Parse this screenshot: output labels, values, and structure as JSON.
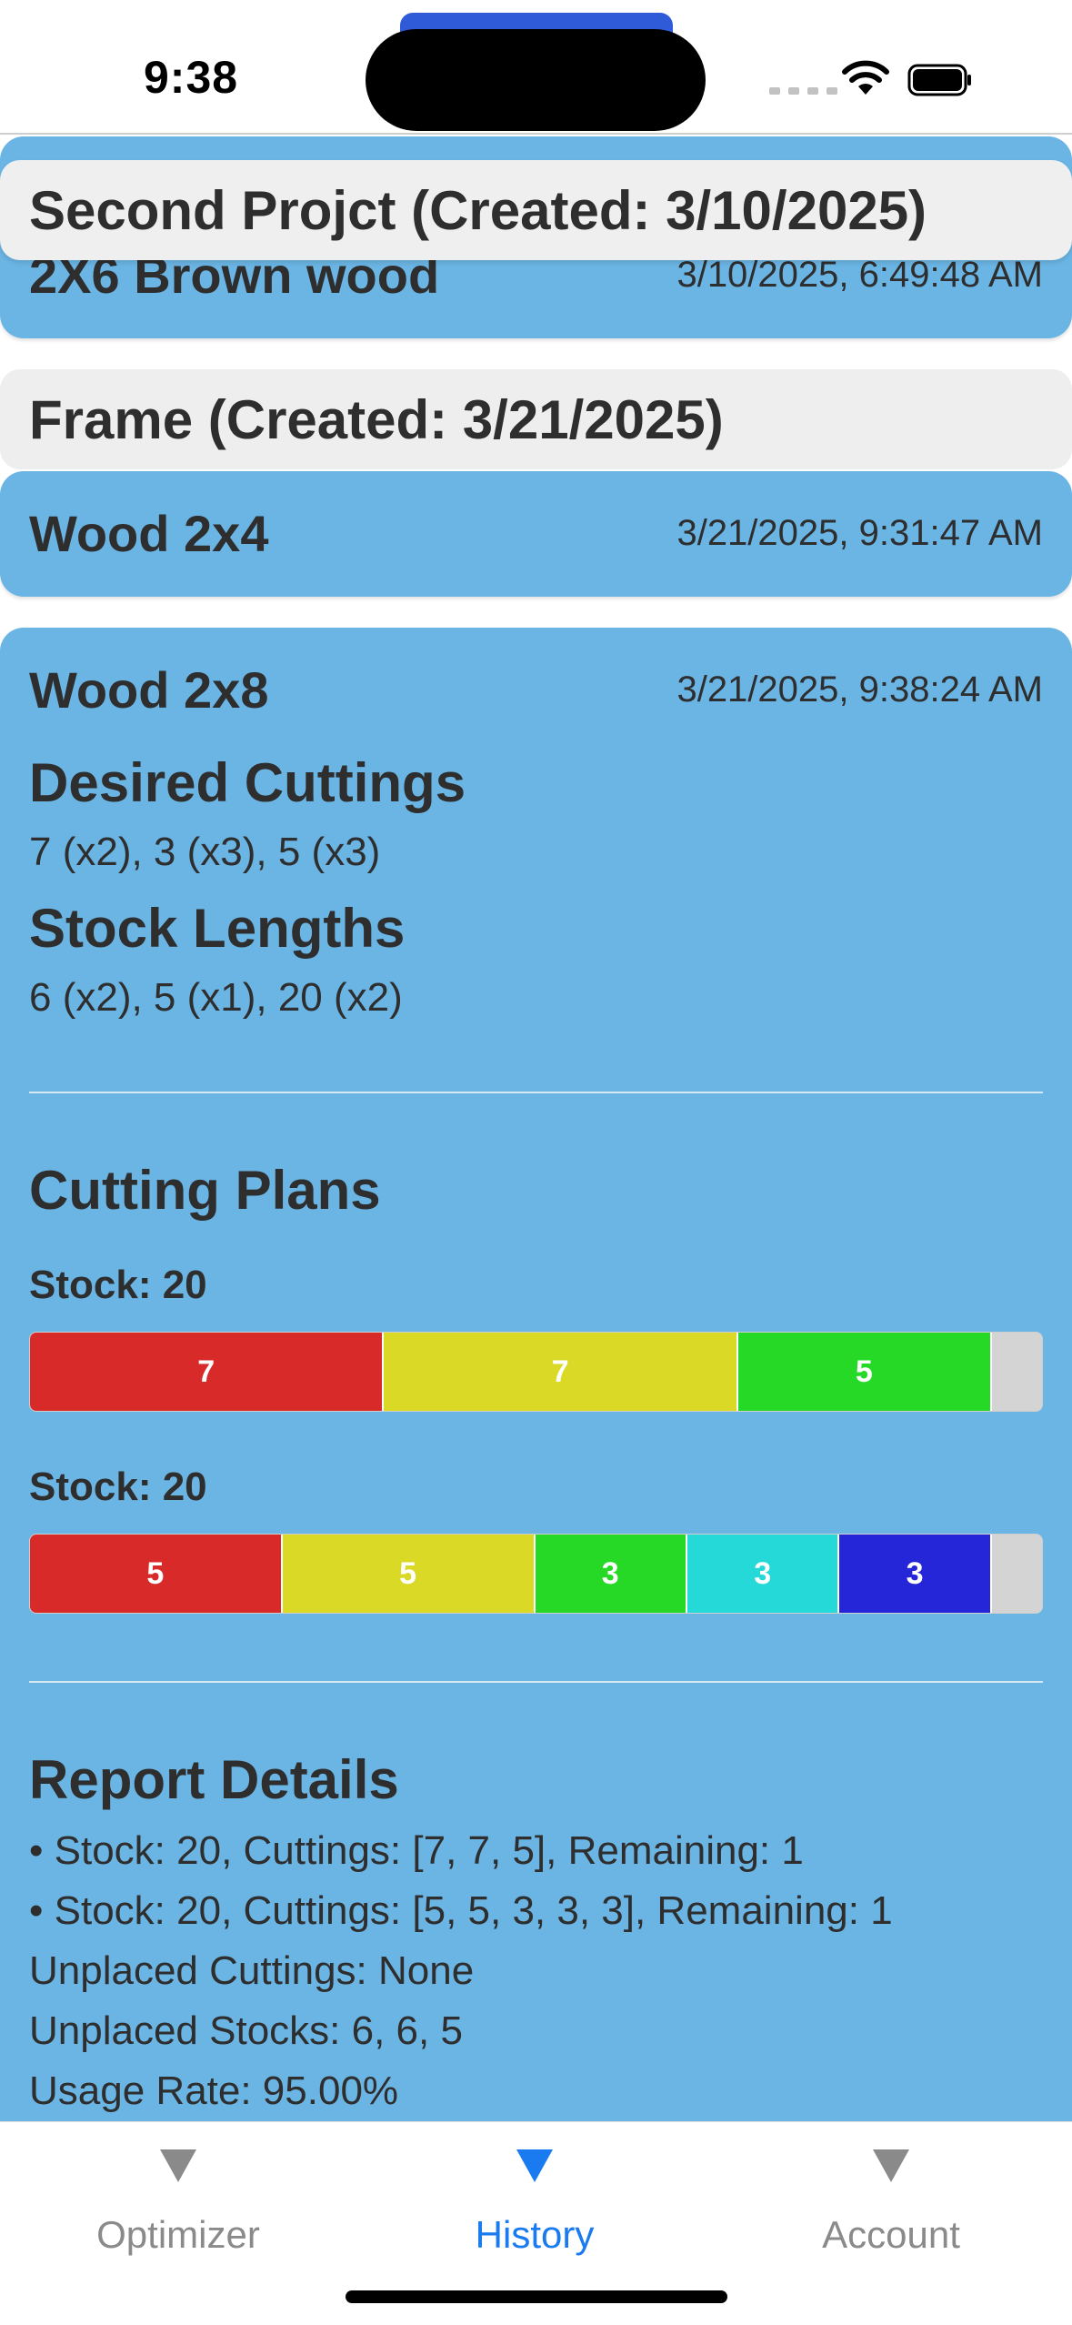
{
  "status_bar": {
    "time": "9:38"
  },
  "history": {
    "projects": [
      {
        "header": "Second Projct (Created: 3/10/2025)",
        "items": [
          {
            "title": "2X6 Brown wood",
            "date": "3/10/2025, 6:49:48 AM"
          }
        ]
      },
      {
        "header": "Frame (Created: 3/21/2025)",
        "items": [
          {
            "title": "Wood 2x4",
            "date": "3/21/2025, 9:31:47 AM"
          },
          {
            "title": "Wood 2x8",
            "date": "3/21/2025, 9:38:24 AM",
            "desired_cuttings_heading": "Desired Cuttings",
            "desired_cuttings": "7 (x2), 3 (x3), 5 (x3)",
            "stock_lengths_heading": "Stock Lengths",
            "stock_lengths": "6 (x2), 5 (x1), 20 (x2)",
            "cutting_plans_heading": "Cutting Plans",
            "plans": [
              {
                "label": "Stock: 20",
                "stock": 20,
                "cuts": [
                  {
                    "value": 7,
                    "label": "7",
                    "color": "#d92a2a"
                  },
                  {
                    "value": 7,
                    "label": "7",
                    "color": "#d9d926"
                  },
                  {
                    "value": 5,
                    "label": "5",
                    "color": "#26d926"
                  }
                ],
                "remaining": 1
              },
              {
                "label": "Stock: 20",
                "stock": 20,
                "cuts": [
                  {
                    "value": 5,
                    "label": "5",
                    "color": "#d92a2a"
                  },
                  {
                    "value": 5,
                    "label": "5",
                    "color": "#d9d926"
                  },
                  {
                    "value": 3,
                    "label": "3",
                    "color": "#26d926"
                  },
                  {
                    "value": 3,
                    "label": "3",
                    "color": "#26d9d9"
                  },
                  {
                    "value": 3,
                    "label": "3",
                    "color": "#2626d9"
                  }
                ],
                "remaining": 1
              }
            ],
            "report_heading": "Report Details",
            "report_lines": [
              "• Stock: 20, Cuttings: [7, 7, 5], Remaining: 1",
              "• Stock: 20, Cuttings: [5, 5, 3, 3, 3], Remaining: 1",
              "Unplaced Cuttings: None",
              "Unplaced Stocks: 6, 6, 5",
              "Usage Rate: 95.00%"
            ]
          }
        ]
      }
    ]
  },
  "tab_bar": {
    "tabs": [
      {
        "label": "Optimizer",
        "active": false
      },
      {
        "label": "History",
        "active": true
      },
      {
        "label": "Account",
        "active": false
      }
    ]
  },
  "colors": {
    "card": "#6bb5e5",
    "header": "#eeeeee",
    "accent": "#1a7af0",
    "remaining": "#d4d4d4"
  }
}
